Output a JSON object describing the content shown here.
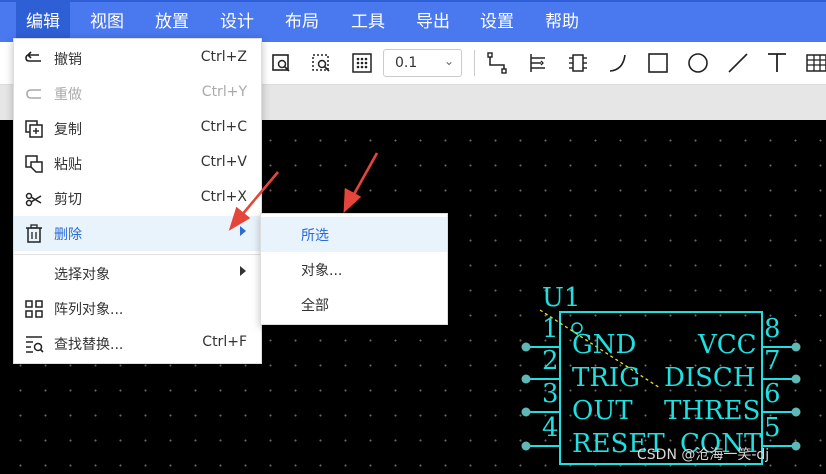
{
  "menubar": {
    "items": [
      {
        "label": "编辑",
        "active": true
      },
      {
        "label": "视图"
      },
      {
        "label": "放置"
      },
      {
        "label": "设计"
      },
      {
        "label": "布局"
      },
      {
        "label": "工具"
      },
      {
        "label": "导出"
      },
      {
        "label": "设置"
      },
      {
        "label": "帮助"
      }
    ]
  },
  "toolbar": {
    "grid_select_value": "0.1",
    "icons": [
      "zoom-area-icon",
      "zoom-selection-icon",
      "grid-icon",
      "wire-icon",
      "netlabel-icon",
      "component-icon",
      "arc-icon",
      "rectangle-icon",
      "circle-icon",
      "line-icon",
      "text-icon",
      "table-icon"
    ]
  },
  "edit_menu": {
    "items": [
      {
        "label": "撤销",
        "shortcut": "Ctrl+Z",
        "icon": "undo-icon"
      },
      {
        "label": "重做",
        "shortcut": "Ctrl+Y",
        "icon": "redo-icon",
        "disabled": true
      },
      {
        "label": "复制",
        "shortcut": "Ctrl+C",
        "icon": "copy-icon"
      },
      {
        "label": "粘贴",
        "shortcut": "Ctrl+V",
        "icon": "paste-icon"
      },
      {
        "label": "剪切",
        "shortcut": "Ctrl+X",
        "icon": "scissors-icon"
      },
      {
        "label": "删除",
        "shortcut": "",
        "icon": "trash-icon",
        "submenu": true,
        "highlighted": true
      },
      {
        "label": "选择对象",
        "shortcut": "",
        "icon": "",
        "submenu": true
      },
      {
        "label": "阵列对象...",
        "shortcut": "",
        "icon": "array-icon"
      },
      {
        "label": "查找替换...",
        "shortcut": "Ctrl+F",
        "icon": "find-replace-icon"
      }
    ]
  },
  "delete_submenu": {
    "items": [
      {
        "label": "所选",
        "highlighted": true
      },
      {
        "label": "对象..."
      },
      {
        "label": "全部"
      }
    ]
  },
  "schematic": {
    "designator": "U1",
    "pin_numbers_left": [
      "1",
      "2",
      "3",
      "4"
    ],
    "pin_numbers_right": [
      "8",
      "7",
      "6",
      "5"
    ],
    "pin_names_left": [
      "GND",
      "TRIG",
      "OUT",
      "RESET"
    ],
    "pin_names_right": [
      "VCC",
      "DISCH",
      "THRES",
      "CONT"
    ]
  },
  "watermark": "CSDN @沧海一笑-dj",
  "colors": {
    "menubar": "#4a78ee",
    "menubar_active": "#2e5fd5",
    "highlight_bg": "#e9f3fc",
    "highlight_text": "#2a6bd8",
    "schematic_cyan": "#1fe0e0",
    "pin_end": "#5fb8b8",
    "arrow": "#e5453a"
  }
}
